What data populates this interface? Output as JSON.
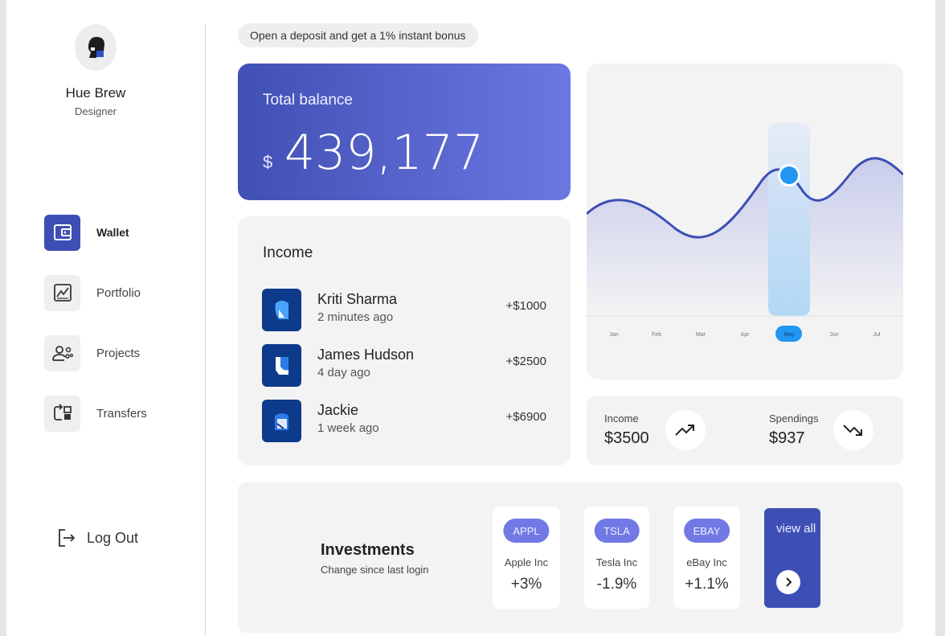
{
  "profile": {
    "name": "Hue Brew",
    "role": "Designer",
    "icon": "user-avatar"
  },
  "nav": {
    "items": [
      {
        "label": "Wallet",
        "icon": "wallet-icon",
        "active": true
      },
      {
        "label": "Portfolio",
        "icon": "chart-icon",
        "active": false
      },
      {
        "label": "Projects",
        "icon": "team-settings-icon",
        "active": false
      },
      {
        "label": "Transfers",
        "icon": "transfer-icon",
        "active": false
      }
    ],
    "logout_label": "Log Out"
  },
  "promo": {
    "text": "Open a deposit and get a 1% instant bonus"
  },
  "balance": {
    "title": "Total balance",
    "currency": "$",
    "value": "439,177"
  },
  "income": {
    "title": "Income",
    "rows": [
      {
        "name": "Kriti Sharma",
        "time": "2 minutes ago",
        "amount": "+$1000"
      },
      {
        "name": "James Hudson",
        "time": "4 day ago",
        "amount": "+$2500"
      },
      {
        "name": "Jackie",
        "time": "1 week ago",
        "amount": "+$6900"
      }
    ]
  },
  "chart": {
    "months": [
      "Jan",
      "Feb",
      "Mar",
      "Apr",
      "May",
      "Jun",
      "Jul"
    ],
    "selected": "May"
  },
  "stats": {
    "income_label": "Income",
    "income_value": "$3500",
    "income_icon": "trending-up-icon",
    "spend_label": "Spendings",
    "spend_value": "$937",
    "spend_icon": "trending-down-icon"
  },
  "investments": {
    "title": "Investments",
    "subtitle": "Change since last login",
    "stocks": [
      {
        "ticker": "APPL",
        "name": "Apple Inc",
        "change": "+3%"
      },
      {
        "ticker": "TSLA",
        "name": "Tesla Inc",
        "change": "-1.9%"
      },
      {
        "ticker": "EBAY",
        "name": "eBay Inc",
        "change": "+1.1%"
      }
    ],
    "view_all": "view all"
  },
  "colors": {
    "accent": "#3d4fb5",
    "accent_light": "#6c77e2",
    "highlight": "#2196f3"
  }
}
